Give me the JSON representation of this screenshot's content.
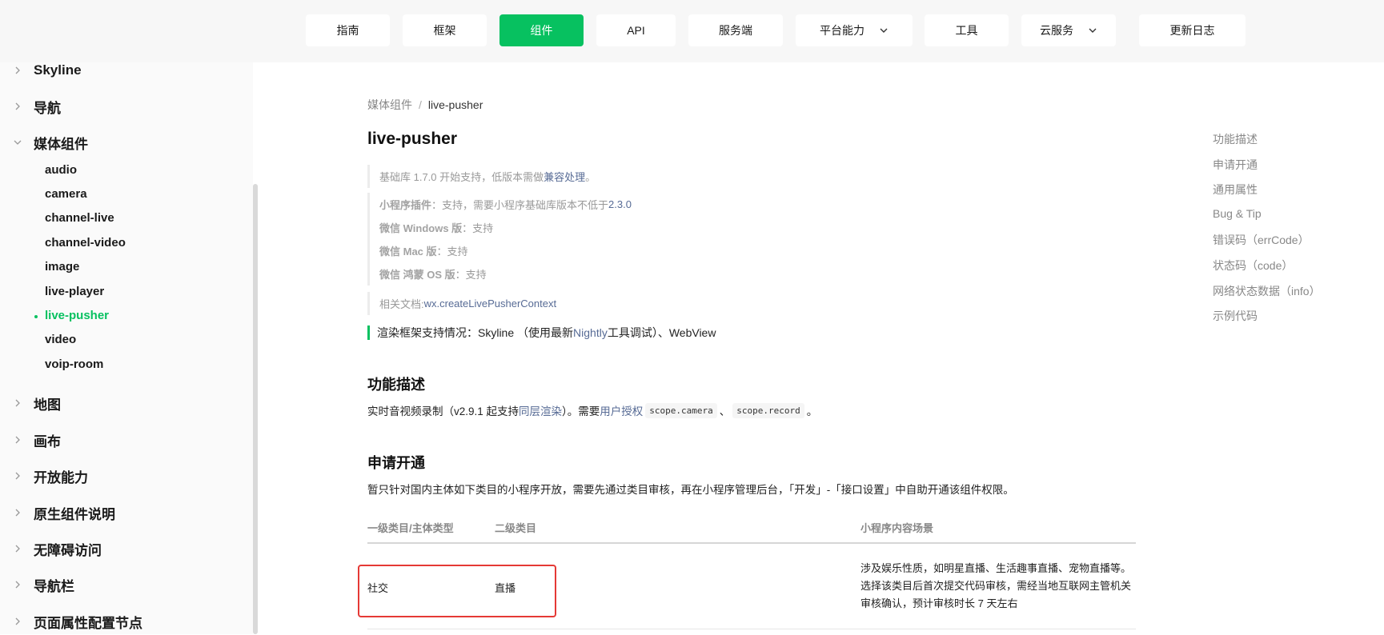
{
  "topnav": {
    "items": [
      {
        "label": "指南"
      },
      {
        "label": "框架"
      },
      {
        "label": "组件",
        "active": true
      },
      {
        "label": "API"
      },
      {
        "label": "服务端"
      },
      {
        "label": "平台能力",
        "dropdown": true
      },
      {
        "label": "工具"
      },
      {
        "label": "云服务",
        "dropdown": true
      },
      {
        "label": "更新日志"
      }
    ]
  },
  "sidebar": {
    "groups_top": [
      {
        "label": "Skyline",
        "icon": "chevron-right-icon"
      },
      {
        "label": "导航",
        "icon": "chevron-right-icon"
      },
      {
        "label": "媒体组件",
        "icon": "chevron-down-icon",
        "expanded": true
      }
    ],
    "media_items": [
      {
        "label": "audio"
      },
      {
        "label": "camera"
      },
      {
        "label": "channel-live"
      },
      {
        "label": "channel-video"
      },
      {
        "label": "image"
      },
      {
        "label": "live-player"
      },
      {
        "label": "live-pusher",
        "active": true
      },
      {
        "label": "video"
      },
      {
        "label": "voip-room"
      }
    ],
    "groups_bottom": [
      {
        "label": "地图"
      },
      {
        "label": "画布"
      },
      {
        "label": "开放能力"
      },
      {
        "label": "原生组件说明"
      },
      {
        "label": "无障碍访问"
      },
      {
        "label": "导航栏"
      },
      {
        "label": "页面属性配置节点"
      }
    ]
  },
  "breadcrumb": {
    "parent": "媒体组件",
    "sep": "/",
    "current": "live-pusher"
  },
  "page_title": "live-pusher",
  "support": {
    "base_prefix": "基础库 1.7.0 开始支持，低版本需做",
    "base_link": "兼容处理",
    "base_suffix": "。",
    "plugin_label": "小程序插件",
    "plugin_text": "：支持，需要小程序基础库版本不低于 ",
    "plugin_version": "2.3.0",
    "windows_label": "微信 Windows 版",
    "windows_text": "：支持",
    "mac_label": "微信 Mac 版",
    "mac_text": "：支持",
    "harmony_label": "微信 鸿蒙 OS 版",
    "harmony_text": "：支持",
    "related_label": "相关文档: ",
    "related_link": "wx.createLivePusherContext"
  },
  "render": {
    "prefix": "渲染框架支持情况：Skyline （使用最新 ",
    "link": "Nightly",
    "suffix": " 工具调试）、WebView"
  },
  "section_desc": {
    "title": "功能描述",
    "text1": "实时音视频录制（v2.9.1 起支持",
    "link1": "同层渲染",
    "text2": "）。需要",
    "link2": "用户授权",
    "code1": "scope.camera",
    "sep": "、",
    "code2": "scope.record",
    "end": "。"
  },
  "section_apply": {
    "title": "申请开通",
    "text": "暂只针对国内主体如下类目的小程序开放，需要先通过类目审核，再在小程序管理后台，「开发」-「接口设置」中自助开通该组件权限。",
    "headers": [
      "一级类目/主体类型",
      "二级类目",
      "小程序内容场景"
    ],
    "row": {
      "cat1": "社交",
      "cat2": "直播",
      "scene": "涉及娱乐性质，如明星直播、生活趣事直播、宠物直播等。选择该类目后首次提交代码审核，需经当地互联网主管机关审核确认，预计审核时长 7 天左右"
    }
  },
  "toc": [
    "功能描述",
    "申请开通",
    "通用属性",
    "Bug & Tip",
    "错误码（errCode）",
    "状态码（code）",
    "网络状态数据（info）",
    "示例代码"
  ],
  "colors": {
    "accent": "#07c160",
    "link": "#576b95",
    "highlight": "#e53935"
  }
}
